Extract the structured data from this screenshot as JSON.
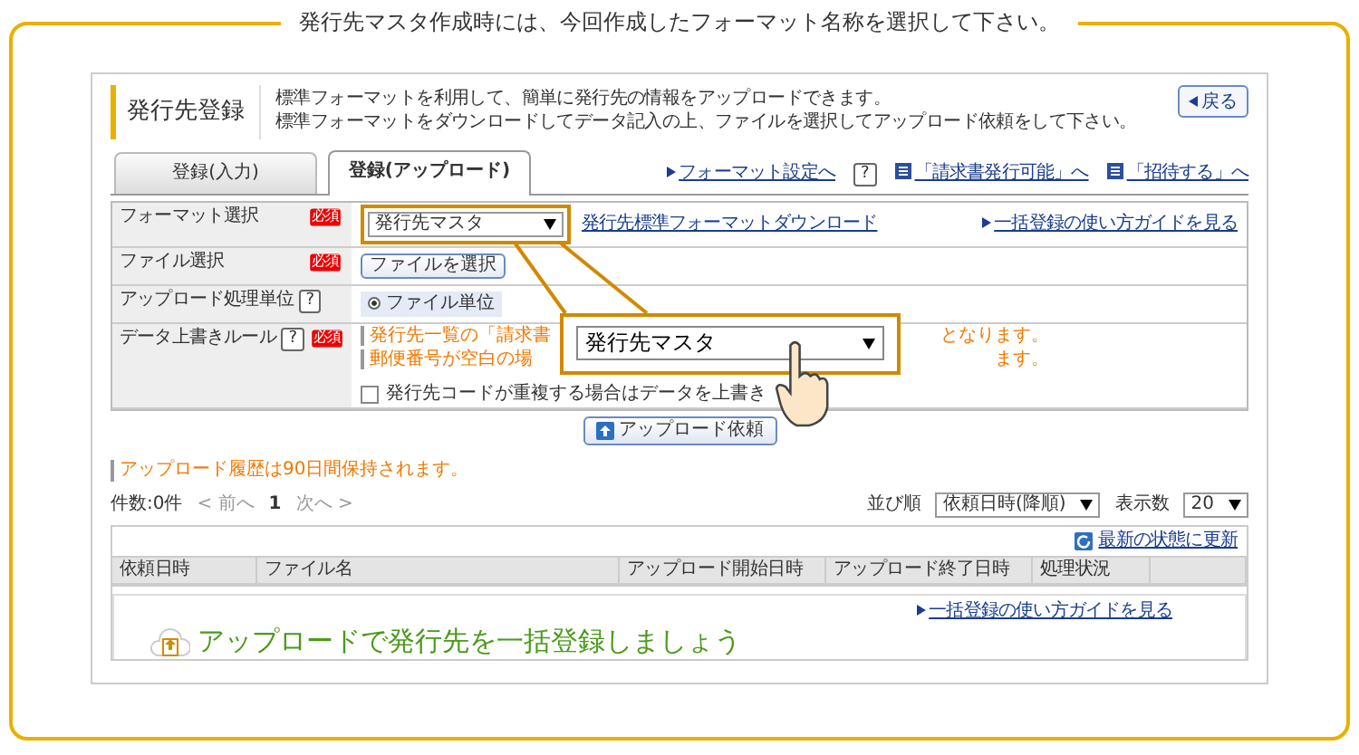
{
  "caption": "発行先マスタ作成時には、今回作成したフォーマット名称を選択して下さい。",
  "page": {
    "title": "発行先登録",
    "description": [
      "標準フォーマットを利用して、簡単に発行先の情報をアップロードできます。",
      "標準フォーマットをダウンロードしてデータ記入の上、ファイルを選択してアップロード依頼をして下さい。"
    ],
    "back_button": "戻る"
  },
  "tabs": [
    {
      "label": "登録(入力)",
      "selected": false
    },
    {
      "label": "登録(アップロード)",
      "selected": true
    }
  ],
  "tab_links": [
    {
      "kind": "arrow",
      "label": "フォーマット設定へ"
    },
    {
      "kind": "help",
      "label": "?"
    },
    {
      "kind": "doc",
      "label": "「請求書発行可能」へ"
    },
    {
      "kind": "doc",
      "label": "「招待する」へ"
    }
  ],
  "form": {
    "rows": [
      {
        "kind": "select",
        "label": "フォーマット選択",
        "required": "必須",
        "value": "発行先マスタ",
        "highlighted": true,
        "link": "発行先標準フォーマットダウンロード",
        "guide_link": "一括登録の使い方ガイドを見る"
      },
      {
        "kind": "file",
        "label": "ファイル選択",
        "required": "必須",
        "button": "ファイルを選択"
      },
      {
        "kind": "radio",
        "label": "アップロード処理単位",
        "help": "?",
        "options": [
          {
            "label": "ファイル単位",
            "selected": true
          }
        ]
      },
      {
        "kind": "rule",
        "label": "データ上書きルール",
        "help": "?",
        "required": "必須",
        "notes": [
          {
            "head": "発行先一覧の「請求書",
            "tail": "となります。"
          },
          {
            "head": "郵便番号が空白の場",
            "tail": "ます。"
          }
        ],
        "checkbox": {
          "label": "発行先コードが重複する場合はデータを上書き",
          "checked": false
        }
      }
    ]
  },
  "upload_button": "アップロード依頼",
  "callout": {
    "value": "発行先マスタ"
  },
  "history_note": "アップロード履歴は90日間保持されます。",
  "pager": {
    "count": "件数:0件",
    "prev": "< 前へ",
    "page": "1",
    "next": "次へ >"
  },
  "sort": {
    "label": "並び順",
    "value": "依頼日時(降順)"
  },
  "per_page": {
    "label": "表示数",
    "value": "20"
  },
  "table": {
    "refresh": "最新の状態に更新",
    "columns": [
      "依頼日時",
      "ファイル名",
      "アップロード開始日時",
      "アップロード終了日時",
      "処理状況"
    ]
  },
  "empty": {
    "guide_link": "一括登録の使い方ガイドを見る",
    "headline": "アップロードで発行先を一括登録しましょう"
  }
}
